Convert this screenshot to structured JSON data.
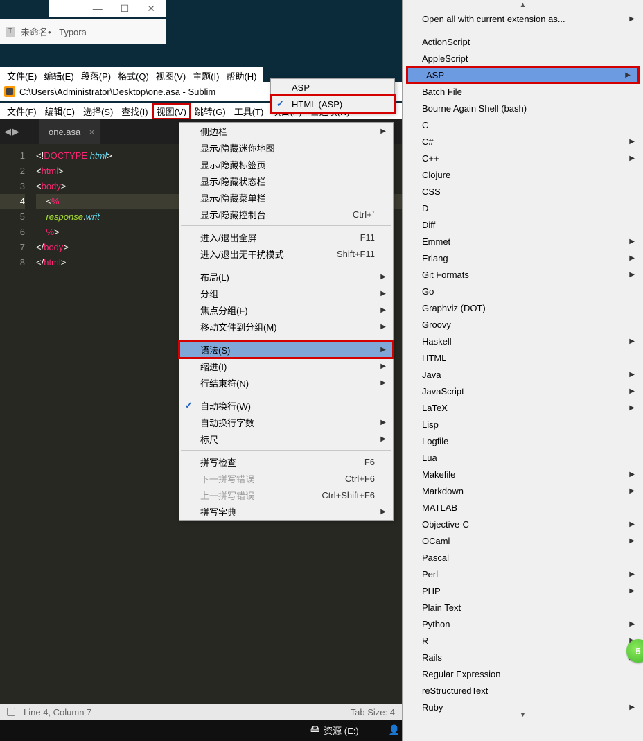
{
  "win_controls": {
    "min": "—",
    "max": "☐",
    "close": "✕"
  },
  "typora": {
    "title": "未命名• - Typora",
    "menu": [
      "文件(E)",
      "编辑(E)",
      "段落(P)",
      "格式(Q)",
      "视图(V)",
      "主题(I)",
      "帮助(H)"
    ]
  },
  "sublime": {
    "title": "C:\\Users\\Administrator\\Desktop\\one.asa - Sublim",
    "menu": [
      "文件(F)",
      "编辑(E)",
      "选择(S)",
      "查找(I)",
      "视图(V)",
      "跳转(G)",
      "工具(T)",
      "项目(P)",
      "首选项(N)"
    ],
    "tab": {
      "name": "one.asa",
      "close": "×"
    },
    "status": {
      "left": "Line 4, Column 7",
      "right": "Tab Size: 4"
    }
  },
  "code": [
    {
      "n": "1",
      "html": "<span class='tk-punc'>&lt;!</span><span class='tk-tag'>DOCTYPE</span> <span class='tk-doctype'>html</span><span class='tk-punc'>&gt;</span>"
    },
    {
      "n": "2",
      "html": "<span class='tk-punc'>&lt;</span><span class='tk-tag'>html</span><span class='tk-punc'>&gt;</span>"
    },
    {
      "n": "3",
      "html": "<span class='tk-punc'>&lt;</span><span class='tk-tag'>body</span><span class='tk-punc'>&gt;</span>"
    },
    {
      "n": "4",
      "html": "    <span class='tk-punc'>&lt;</span><span class='tk-tag'>%</span>",
      "cur": true
    },
    {
      "n": "5",
      "html": "    <span class='tk-id'>response</span><span class='tk-punc'>.</span><span class='tk-kw'>writ</span>"
    },
    {
      "n": "6",
      "html": "    <span class='tk-tag'>%</span><span class='tk-punc'>&gt;</span>"
    },
    {
      "n": "7",
      "html": "<span class='tk-punc'>&lt;/</span><span class='tk-tag'>body</span><span class='tk-punc'>&gt;</span>"
    },
    {
      "n": "8",
      "html": "<span class='tk-punc'>&lt;/</span><span class='tk-tag'>html</span><span class='tk-punc'>&gt;</span>"
    }
  ],
  "asp_menu": [
    {
      "label": "ASP"
    },
    {
      "label": "HTML (ASP)",
      "checked": true,
      "redbox": true
    }
  ],
  "view_menu": [
    {
      "label": "侧边栏",
      "arrow": true
    },
    {
      "label": "显示/隐藏迷你地图"
    },
    {
      "label": "显示/隐藏标签页"
    },
    {
      "label": "显示/隐藏状态栏"
    },
    {
      "label": "显示/隐藏菜单栏"
    },
    {
      "label": "显示/隐藏控制台",
      "shortcut": "Ctrl+`"
    },
    {
      "sep": true
    },
    {
      "label": "进入/退出全屏",
      "shortcut": "F11"
    },
    {
      "label": "进入/退出无干扰模式",
      "shortcut": "Shift+F11"
    },
    {
      "sep": true
    },
    {
      "label": "布局(L)",
      "arrow": true
    },
    {
      "label": "分组",
      "arrow": true
    },
    {
      "label": "焦点分组(F)",
      "arrow": true
    },
    {
      "label": "移动文件到分组(M)",
      "arrow": true
    },
    {
      "sep": true
    },
    {
      "label": "语法(S)",
      "arrow": true,
      "hl": true,
      "redbox": true
    },
    {
      "label": "缩进(I)",
      "arrow": true
    },
    {
      "label": "行结束符(N)",
      "arrow": true
    },
    {
      "sep": true
    },
    {
      "label": "自动换行(W)",
      "checked": true
    },
    {
      "label": "自动换行字数",
      "arrow": true
    },
    {
      "label": "标尺",
      "arrow": true
    },
    {
      "sep": true
    },
    {
      "label": "拼写检查",
      "shortcut": "F6"
    },
    {
      "label": "下一拼写错误",
      "shortcut": "Ctrl+F6",
      "disabled": true
    },
    {
      "label": "上一拼写错误",
      "shortcut": "Ctrl+Shift+F6",
      "disabled": true
    },
    {
      "label": "拼写字典",
      "arrow": true
    }
  ],
  "syntax_menu": {
    "top": "Open all with current extension as...",
    "items": [
      {
        "label": "ActionScript"
      },
      {
        "label": "AppleScript"
      },
      {
        "label": "ASP",
        "arrow": true,
        "hl": true,
        "redbox": true
      },
      {
        "label": "Batch File"
      },
      {
        "label": "Bourne Again Shell (bash)"
      },
      {
        "label": "C"
      },
      {
        "label": "C#",
        "arrow": true
      },
      {
        "label": "C++",
        "arrow": true
      },
      {
        "label": "Clojure"
      },
      {
        "label": "CSS"
      },
      {
        "label": "D"
      },
      {
        "label": "Diff"
      },
      {
        "label": "Emmet",
        "arrow": true
      },
      {
        "label": "Erlang",
        "arrow": true
      },
      {
        "label": "Git Formats",
        "arrow": true
      },
      {
        "label": "Go"
      },
      {
        "label": "Graphviz (DOT)"
      },
      {
        "label": "Groovy"
      },
      {
        "label": "Haskell",
        "arrow": true
      },
      {
        "label": "HTML"
      },
      {
        "label": "Java",
        "arrow": true
      },
      {
        "label": "JavaScript",
        "arrow": true
      },
      {
        "label": "LaTeX",
        "arrow": true
      },
      {
        "label": "Lisp"
      },
      {
        "label": "Logfile"
      },
      {
        "label": "Lua"
      },
      {
        "label": "Makefile",
        "arrow": true
      },
      {
        "label": "Markdown",
        "arrow": true
      },
      {
        "label": "MATLAB"
      },
      {
        "label": "Objective-C",
        "arrow": true
      },
      {
        "label": "OCaml",
        "arrow": true
      },
      {
        "label": "Pascal"
      },
      {
        "label": "Perl",
        "arrow": true
      },
      {
        "label": "PHP",
        "arrow": true
      },
      {
        "label": "Plain Text"
      },
      {
        "label": "Python",
        "arrow": true
      },
      {
        "label": "R",
        "arrow": true
      },
      {
        "label": "Rails",
        "arrow": true
      },
      {
        "label": "Regular Expression"
      },
      {
        "label": "reStructuredText"
      },
      {
        "label": "Ruby",
        "arrow": true
      }
    ]
  },
  "taskbar": {
    "drive": "资源 (E:)"
  },
  "badge": "5"
}
